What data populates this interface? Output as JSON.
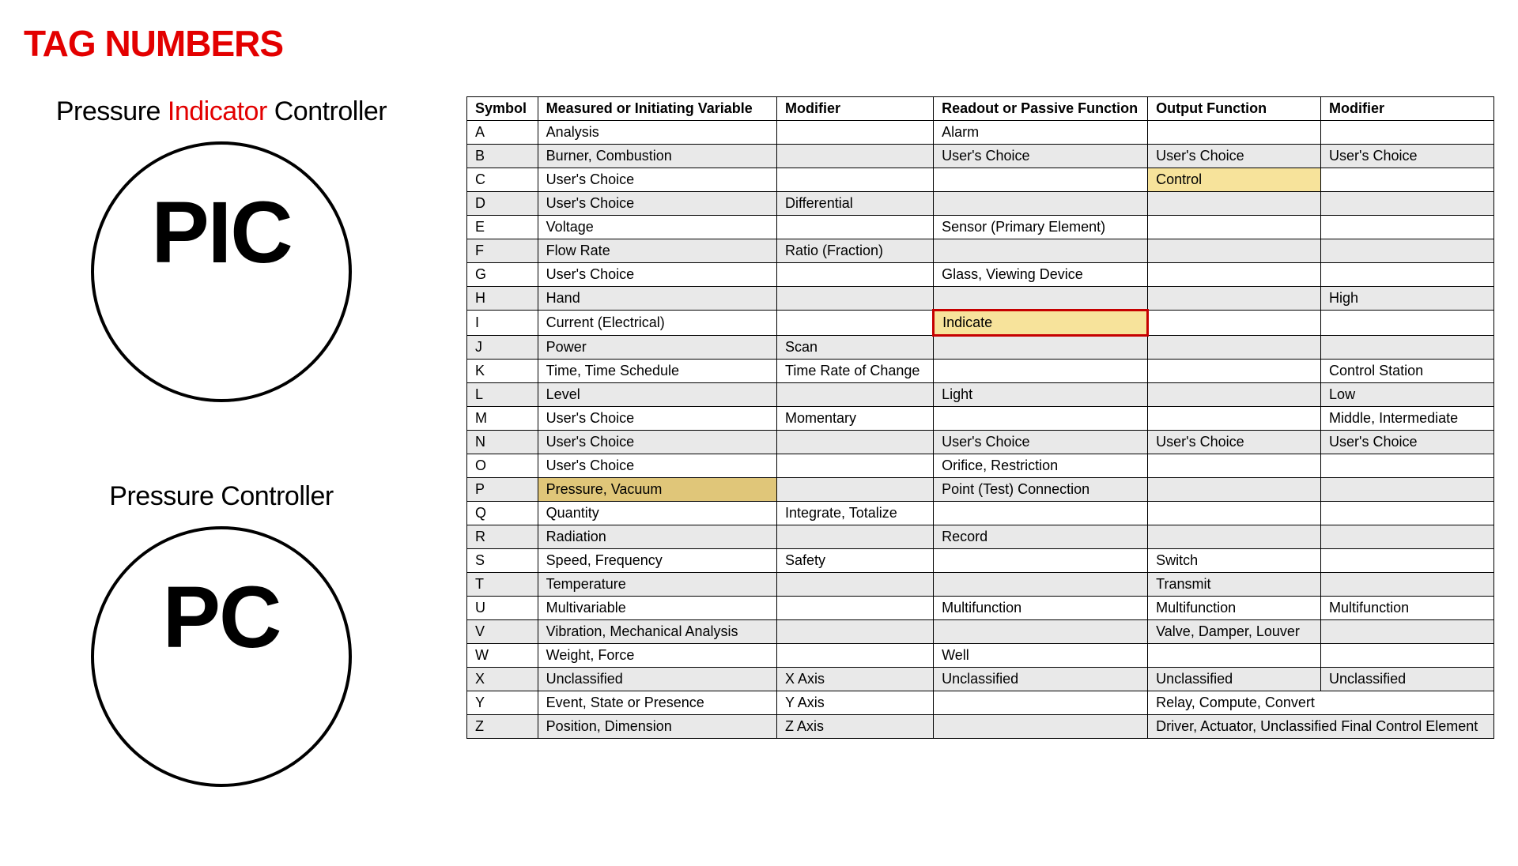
{
  "title": "TAG NUMBERS",
  "left": {
    "block1": {
      "label_pre": "Pressure ",
      "label_red": "Indicator",
      "label_post": " Controller",
      "code": "PIC"
    },
    "block2": {
      "label": "Pressure Controller",
      "code": "PC"
    }
  },
  "table": {
    "headers": [
      "Symbol",
      "Measured or Initiating Variable",
      "Modifier",
      "Readout or Passive Function",
      "Output Function",
      "Modifier"
    ],
    "rows": [
      {
        "cells": [
          "A",
          "Analysis",
          "",
          "Alarm",
          "",
          ""
        ]
      },
      {
        "cells": [
          "B",
          "Burner, Combustion",
          "",
          "User's Choice",
          "User's Choice",
          "User's Choice"
        ]
      },
      {
        "cells": [
          "C",
          "User's Choice",
          "",
          "",
          "Control",
          ""
        ],
        "hl": {
          "4": "yellow"
        }
      },
      {
        "cells": [
          "D",
          "User's Choice",
          "Differential",
          "",
          "",
          ""
        ]
      },
      {
        "cells": [
          "E",
          "Voltage",
          "",
          "Sensor (Primary Element)",
          "",
          ""
        ]
      },
      {
        "cells": [
          "F",
          "Flow Rate",
          "Ratio (Fraction)",
          "",
          "",
          ""
        ]
      },
      {
        "cells": [
          "G",
          "User's Choice",
          "",
          "Glass, Viewing Device",
          "",
          ""
        ]
      },
      {
        "cells": [
          "H",
          "Hand",
          "",
          "",
          "",
          "High"
        ]
      },
      {
        "cells": [
          "I",
          "Current (Electrical)",
          "",
          "Indicate",
          "",
          ""
        ],
        "hl": {
          "3": "redborder"
        }
      },
      {
        "cells": [
          "J",
          "Power",
          "Scan",
          "",
          "",
          ""
        ]
      },
      {
        "cells": [
          "K",
          "Time, Time Schedule",
          "Time Rate of Change",
          "",
          "",
          "Control Station"
        ]
      },
      {
        "cells": [
          "L",
          "Level",
          "",
          "Light",
          "",
          "Low"
        ]
      },
      {
        "cells": [
          "M",
          "User's Choice",
          "Momentary",
          "",
          "",
          "Middle, Intermediate"
        ]
      },
      {
        "cells": [
          "N",
          "User's Choice",
          "",
          "User's Choice",
          "User's Choice",
          "User's Choice"
        ]
      },
      {
        "cells": [
          "O",
          "User's Choice",
          "",
          "Orifice, Restriction",
          "",
          ""
        ]
      },
      {
        "cells": [
          "P",
          "Pressure, Vacuum",
          "",
          "Point (Test) Connection",
          "",
          ""
        ],
        "hl": {
          "1": "gold"
        }
      },
      {
        "cells": [
          "Q",
          "Quantity",
          "Integrate, Totalize",
          "",
          "",
          ""
        ]
      },
      {
        "cells": [
          "R",
          "Radiation",
          "",
          "Record",
          "",
          ""
        ]
      },
      {
        "cells": [
          "S",
          "Speed, Frequency",
          "Safety",
          "",
          "Switch",
          ""
        ]
      },
      {
        "cells": [
          "T",
          "Temperature",
          "",
          "",
          "Transmit",
          ""
        ]
      },
      {
        "cells": [
          "U",
          "Multivariable",
          "",
          "Multifunction",
          "Multifunction",
          "Multifunction"
        ]
      },
      {
        "cells": [
          "V",
          "Vibration, Mechanical Analysis",
          "",
          "",
          "Valve, Damper, Louver",
          ""
        ]
      },
      {
        "cells": [
          "W",
          "Weight, Force",
          "",
          "Well",
          "",
          ""
        ]
      },
      {
        "cells": [
          "X",
          "Unclassified",
          "X Axis",
          "Unclassified",
          "Unclassified",
          "Unclassified"
        ]
      },
      {
        "cells": [
          "Y",
          "Event, State or Presence",
          "Y Axis",
          "",
          "Relay, Compute, Convert"
        ],
        "span": {
          "4": 2
        }
      },
      {
        "cells": [
          "Z",
          "Position, Dimension",
          "Z Axis",
          "",
          "Driver, Actuator, Unclassified Final Control Element"
        ],
        "span": {
          "4": 2
        }
      }
    ]
  }
}
